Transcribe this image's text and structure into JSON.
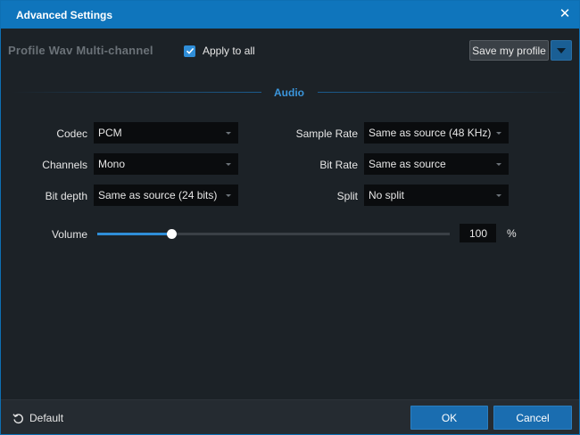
{
  "window": {
    "title": "Advanced Settings",
    "close_icon": "close-icon"
  },
  "profile": {
    "label": "Profile Wav Multi-channel",
    "apply_to_all": {
      "label": "Apply to all",
      "checked": true
    },
    "save_label": "Save my profile"
  },
  "audio": {
    "section_title": "Audio",
    "left_fields": [
      {
        "label": "Codec",
        "value": "PCM"
      },
      {
        "label": "Channels",
        "value": "Mono"
      },
      {
        "label": "Bit depth",
        "value": "Same as source (24 bits)"
      }
    ],
    "right_fields": [
      {
        "label": "Sample Rate",
        "value": "Same as source (48 KHz)"
      },
      {
        "label": "Bit Rate",
        "value": "Same as source"
      },
      {
        "label": "Split",
        "value": "No split"
      }
    ],
    "volume": {
      "label": "Volume",
      "value": "100",
      "unit": "%",
      "slider_fraction": 0.21
    }
  },
  "footer": {
    "default_label": "Default",
    "ok_label": "OK",
    "cancel_label": "Cancel"
  },
  "colors": {
    "accent": "#0f75bc",
    "section_title": "#3b96dc",
    "background": "#1c2227",
    "button": "#1a6db0"
  }
}
